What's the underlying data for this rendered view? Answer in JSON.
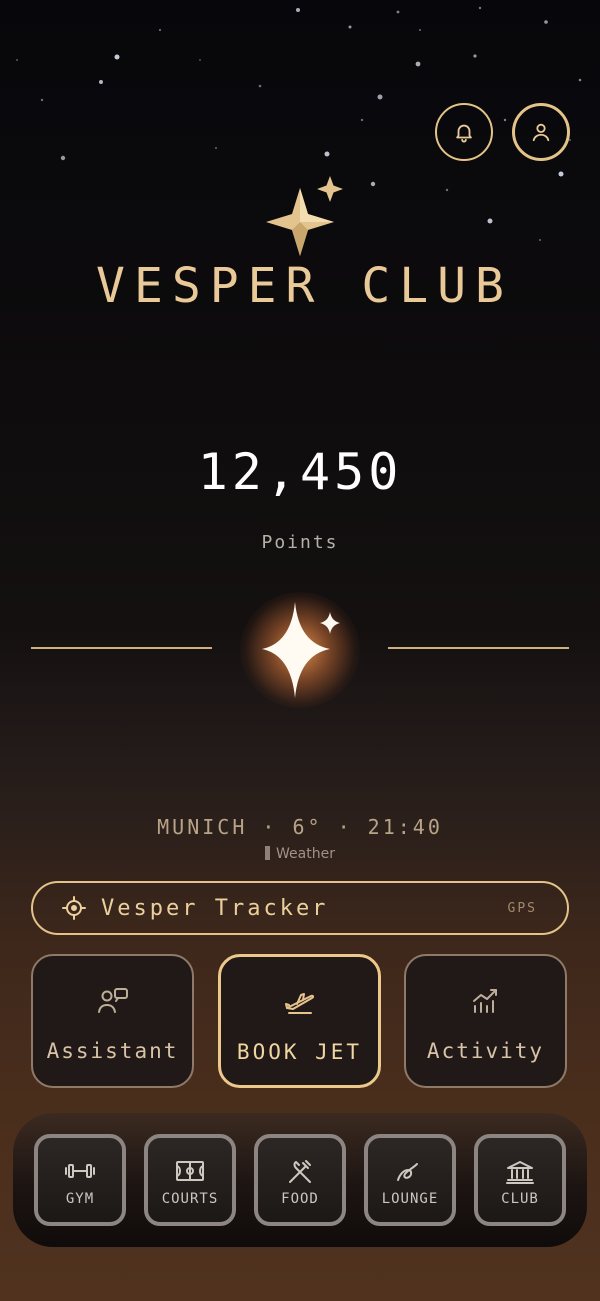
{
  "header": {
    "brand": "VESPER CLUB",
    "bell_icon": "bell-icon",
    "profile_icon": "user-icon"
  },
  "points": {
    "value": "12,450",
    "label": "Points"
  },
  "status": {
    "city": "MUNICH",
    "temperature": "6°",
    "time": "21:40",
    "line": "MUNICH · 6° · 21:40",
    "weather_label": "Weather"
  },
  "tracker": {
    "label": "Vesper Tracker",
    "tag": "GPS",
    "icon": "crosshair-icon"
  },
  "cards": [
    {
      "label": "Assistant",
      "icon": "chat-people-icon"
    },
    {
      "label": "BOOK JET",
      "icon": "plane-takeoff-icon"
    },
    {
      "label": "Activity",
      "icon": "chart-trend-icon"
    }
  ],
  "dock": [
    {
      "label": "GYM",
      "icon": "dumbbell-icon"
    },
    {
      "label": "COURTS",
      "icon": "court-icon"
    },
    {
      "label": "FOOD",
      "icon": "utensils-icon"
    },
    {
      "label": "LOUNGE",
      "icon": "lounge-icon"
    },
    {
      "label": "CLUB",
      "icon": "building-icon"
    }
  ],
  "colors": {
    "accent_gold": "#e3c388",
    "text_white": "#ffffff",
    "background_top": "#07070b",
    "background_bottom": "#50321f"
  }
}
